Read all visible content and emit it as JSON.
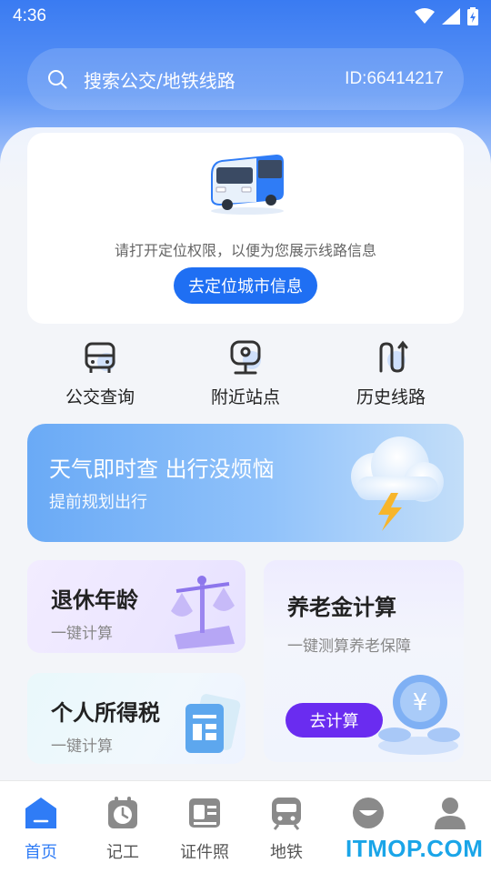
{
  "status_bar": {
    "time": "4:36"
  },
  "search": {
    "placeholder": "搜索公交/地铁线路",
    "user_id": "ID:66414217"
  },
  "location_card": {
    "message": "请打开定位权限，以便为您展示线路信息",
    "button_label": "去定位城市信息"
  },
  "quick_actions": [
    {
      "label": "公交查询",
      "icon": "bus-icon"
    },
    {
      "label": "附近站点",
      "icon": "nearby-station-icon"
    },
    {
      "label": "历史线路",
      "icon": "history-route-icon"
    }
  ],
  "weather_banner": {
    "title": "天气即时查 出行没烦恼",
    "subtitle": "提前规划出行"
  },
  "retire_card": {
    "title": "退休年龄",
    "subtitle": "一键计算"
  },
  "tax_card": {
    "title": "个人所得税",
    "subtitle": "一键计算"
  },
  "pension_card": {
    "title": "养老金计算",
    "subtitle": "一键测算养老保障",
    "button_label": "去计算"
  },
  "bottom_nav": [
    {
      "label": "首页",
      "icon": "home-icon",
      "active": true
    },
    {
      "label": "记工",
      "icon": "clock-icon",
      "active": false
    },
    {
      "label": "证件照",
      "icon": "id-card-icon",
      "active": false
    },
    {
      "label": "地铁",
      "icon": "metro-icon",
      "active": false
    },
    {
      "label": "",
      "icon": "face-icon",
      "active": false
    },
    {
      "label": "",
      "icon": "profile-icon",
      "active": false
    }
  ],
  "watermark": "ITMOP.COM",
  "colors": {
    "primary": "#1f6ff3",
    "accent_purple": "#6a2cf0",
    "nav_active": "#2f7cf6"
  }
}
